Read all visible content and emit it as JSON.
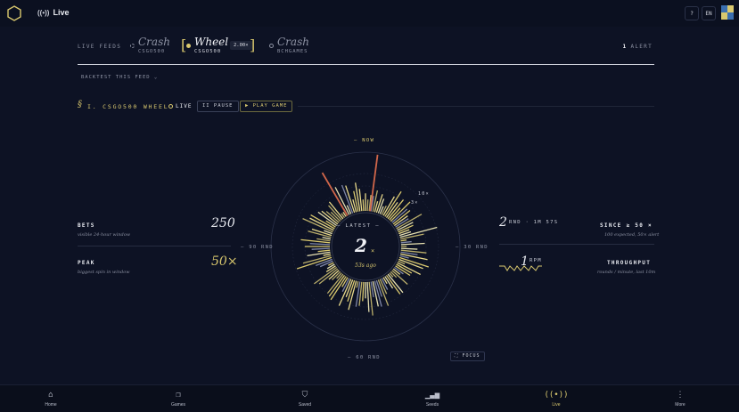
{
  "header": {
    "live_label": "Live",
    "help_icon": "?",
    "lang": "EN"
  },
  "feeds": {
    "label": "LIVE FEEDS",
    "items": [
      {
        "name": "Crash",
        "sub": "CSGO500"
      },
      {
        "name": "Wheel",
        "sub": "CSGO500",
        "multiplier": "2.00×"
      },
      {
        "name": "Crash",
        "sub": "BCHGAMES"
      }
    ],
    "alert_count": "1",
    "alert_label": "ALERT"
  },
  "backtest_label": "BACKTEST THIS FEED ⌄",
  "section": {
    "symbol": "§",
    "title": "I. CSGO500 WHEEL",
    "live": "LIVE",
    "pause": "II PAUSE",
    "play": "▶ PLAY GAME"
  },
  "stats_left": {
    "bets_label": "BETS",
    "bets_sub": "visible 24-hour window",
    "bets_value": "250",
    "peak_label": "PEAK",
    "peak_sub": "biggest spin in window",
    "peak_value": "50×"
  },
  "stats_right": {
    "since_value": "2",
    "since_unit": "RND · 1M 57S",
    "since_label": "SINCE ≥ 50 ×",
    "since_sub": "100 expected, 50× alert",
    "rpm_value": "1",
    "rpm_unit": "RPM",
    "throughput_label": "THROUGHPUT",
    "throughput_sub": "rounds / minute, last 10m"
  },
  "wheel": {
    "now_label": "— NOW",
    "left_label": "— 90 RND",
    "right_label": "— 30 RND",
    "bottom_label": "— 60 RND",
    "ring_10": "10×",
    "ring_3": "3×",
    "latest_label": "— LATEST —",
    "latest_value": "2",
    "latest_x": "×",
    "latest_ago": "53s ago",
    "focus": "⛶ FOCUS"
  },
  "colors": {
    "background": "#0d1224",
    "accent": "#d9c86e",
    "hot": "#d0664a"
  },
  "nav": {
    "items": [
      {
        "label": "Home",
        "icon": "home-icon"
      },
      {
        "label": "Games",
        "icon": "games-icon"
      },
      {
        "label": "Saved",
        "icon": "bookmark-icon"
      },
      {
        "label": "Seeds",
        "icon": "bars-icon"
      },
      {
        "label": "Live",
        "icon": "broadcast-icon"
      },
      {
        "label": "More",
        "icon": "more-icon"
      }
    ]
  }
}
